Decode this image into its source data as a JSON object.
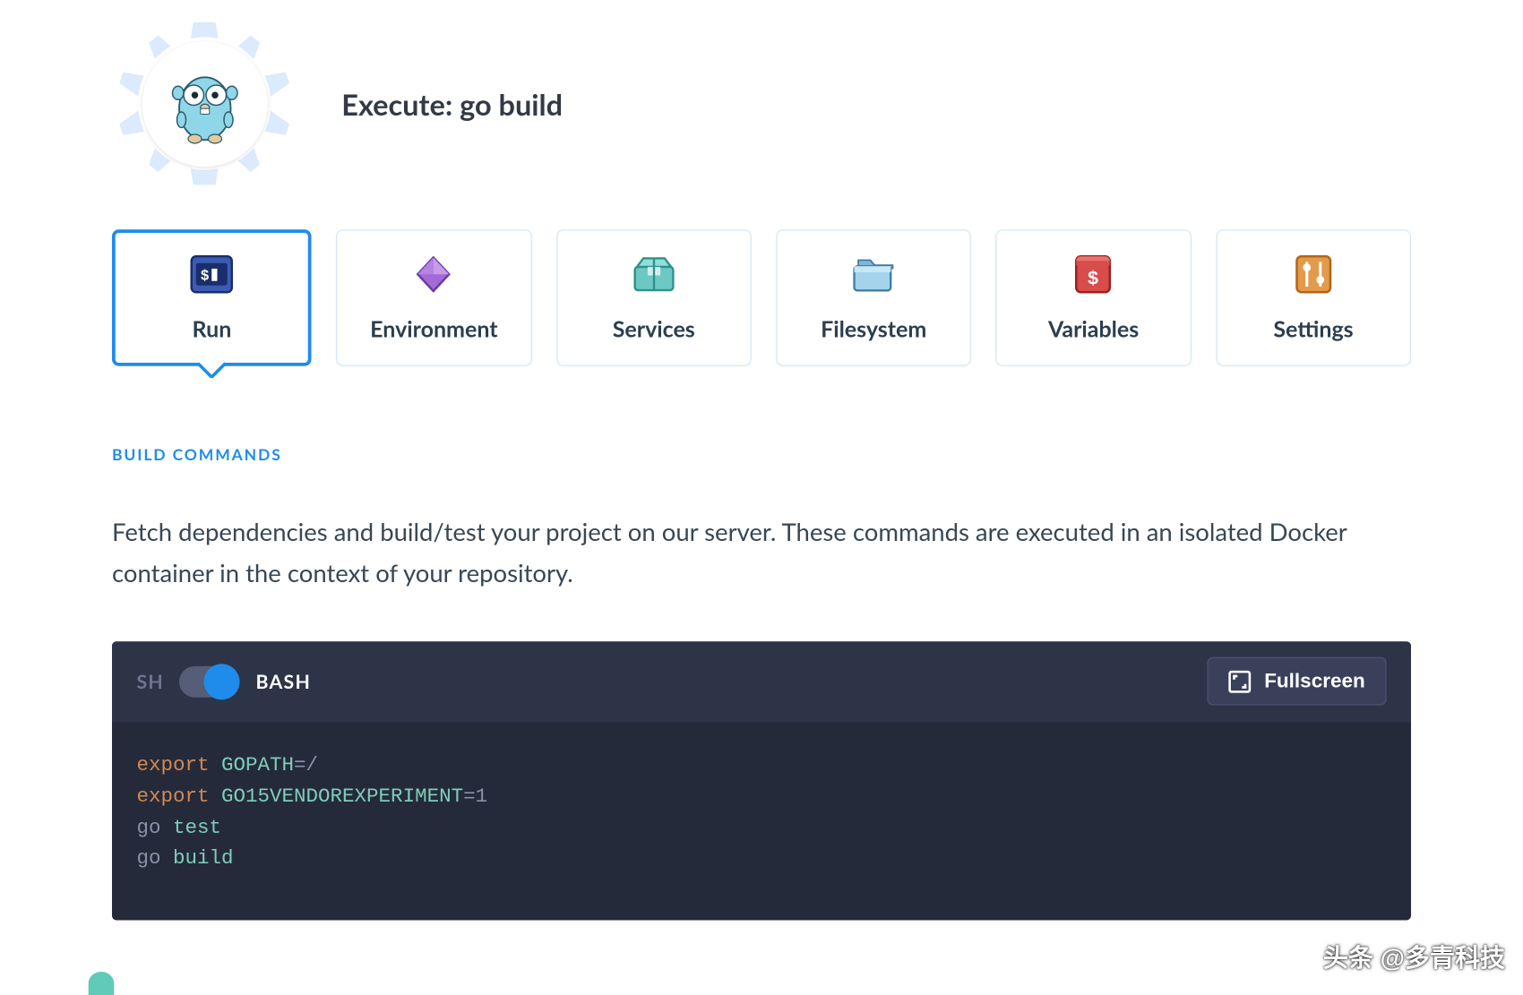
{
  "header": {
    "title": "Execute: go build"
  },
  "tabs": [
    {
      "key": "run",
      "label": "Run",
      "active": true
    },
    {
      "key": "environment",
      "label": "Environment",
      "active": false
    },
    {
      "key": "services",
      "label": "Services",
      "active": false
    },
    {
      "key": "filesystem",
      "label": "Filesystem",
      "active": false
    },
    {
      "key": "variables",
      "label": "Variables",
      "active": false
    },
    {
      "key": "settings",
      "label": "Settings",
      "active": false
    }
  ],
  "section": {
    "title": "BUILD COMMANDS",
    "description": "Fetch dependencies and build/test your project on our server. These commands are executed in an isolated Docker container in the context of your repository."
  },
  "editor": {
    "shell_left": "SH",
    "shell_right": "BASH",
    "shell_active": "BASH",
    "fullscreen_label": "Fullscreen",
    "code_lines": [
      {
        "tokens": [
          [
            "k",
            "export"
          ],
          [
            " ",
            ""
          ],
          [
            "v",
            "GOPATH"
          ],
          [
            "",
            "=/"
          ]
        ]
      },
      {
        "tokens": [
          [
            "k",
            "export"
          ],
          [
            " ",
            ""
          ],
          [
            "v",
            "GO15VENDOREXPERIMENT"
          ],
          [
            "",
            "=1"
          ]
        ]
      },
      {
        "tokens": [
          [
            "",
            "go "
          ],
          [
            "v",
            "test"
          ]
        ]
      },
      {
        "tokens": [
          [
            "",
            "go "
          ],
          [
            "v",
            "build"
          ]
        ]
      }
    ]
  },
  "watermark": "头条 @多青科技"
}
